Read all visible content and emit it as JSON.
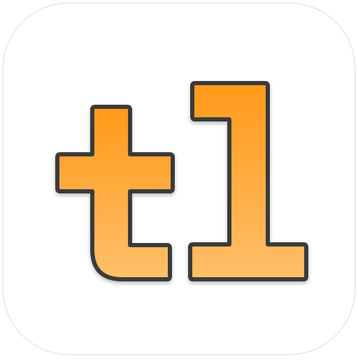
{
  "app_icon": {
    "logo_text": "t1",
    "colors": {
      "tile_background": "#ffffff",
      "tile_border": "#ececec",
      "glyph_fill_top": "#ff9a1a",
      "glyph_fill_bottom": "#ffbf6a",
      "glyph_outline": "#3a3a3a"
    }
  }
}
